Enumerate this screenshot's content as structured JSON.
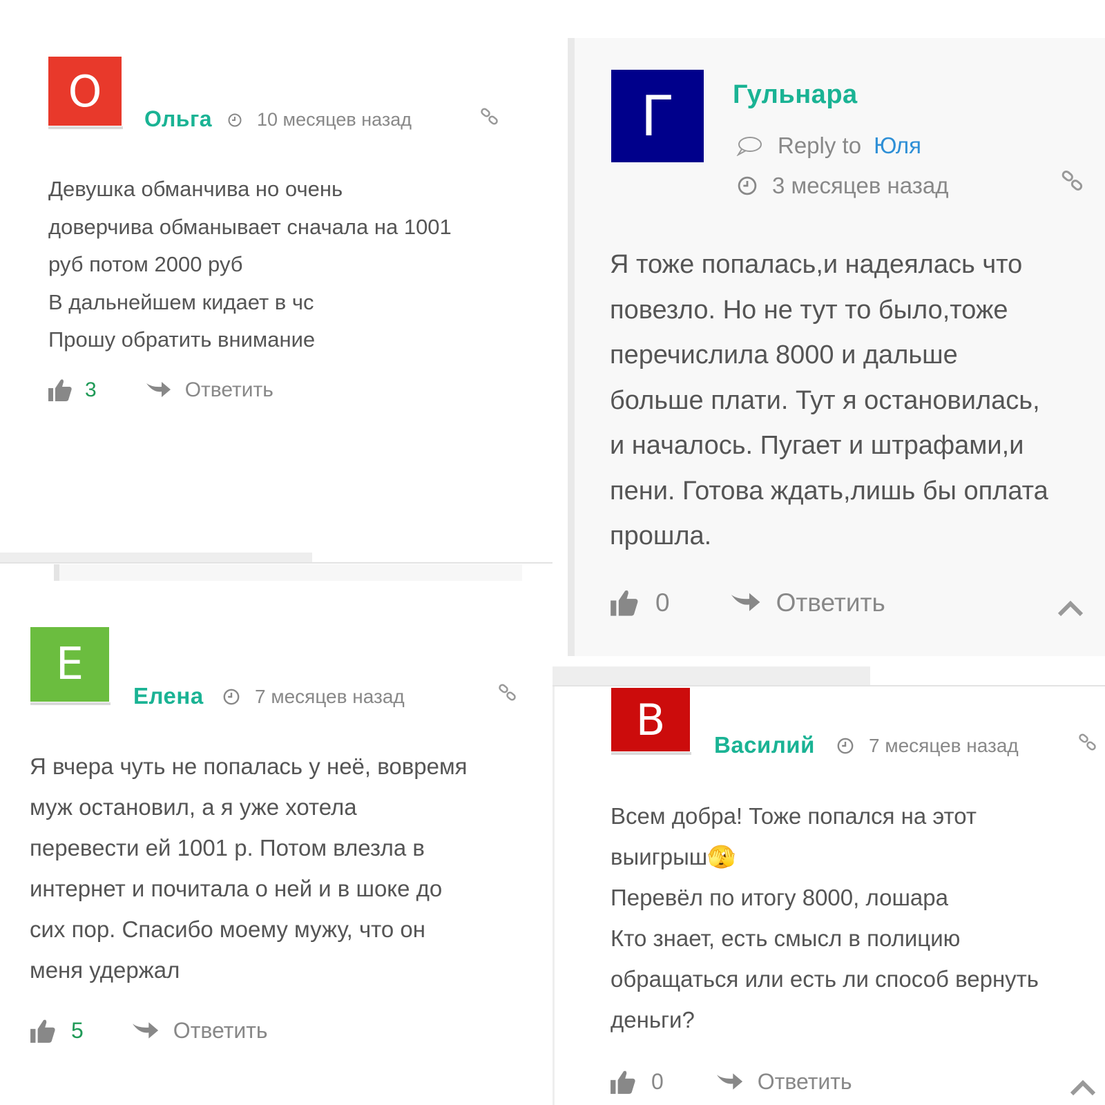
{
  "colors": {
    "accent": "#1ab394",
    "like": "#1f9a57",
    "reply_to_name": "#2e8fd6",
    "meta": "#888888",
    "text": "#555555"
  },
  "comments": [
    {
      "avatar_letter": "О",
      "avatar_color": "#e8392b",
      "author": "Ольга",
      "time": "10 месяцев назад",
      "lines": [
        "Девушка обманчива но очень",
        "доверчива обманывает сначала на 1001",
        "руб потом 2000 руб",
        "В дальнейшем кидает в чс",
        "Прошу обратить внимание"
      ],
      "likes": "3",
      "reply_label": "Ответить"
    },
    {
      "avatar_letter": "Г",
      "avatar_color": "#00008b",
      "author": "Гульнара",
      "reply_to_label": "Reply to",
      "reply_to_name": "Юля",
      "time": "3 месяцев назад",
      "lines": [
        "Я тоже попалась,и надеялась что",
        "повезло. Но не тут то было,тоже",
        "перечислила 8000 и дальше",
        "больше плати. Тут я остановилась,",
        "и началось. Пугает и штрафами,и",
        "пени. Готова ждать,лишь бы оплата",
        "прошла."
      ],
      "likes": "0",
      "reply_label": "Ответить"
    },
    {
      "avatar_letter": "Е",
      "avatar_color": "#6bbd3f",
      "author": "Елена",
      "time": "7 месяцев назад",
      "lines": [
        "Я вчера чуть не попалась у неё, вовремя",
        "муж остановил, а я уже хотела",
        "перевести ей 1001 р. Потом влезла в",
        "интернет и почитала о ней и в шоке до",
        "сих пор. Спасибо моему мужу, что он",
        "меня удержал"
      ],
      "likes": "5",
      "reply_label": "Ответить"
    },
    {
      "avatar_letter": "В",
      "avatar_color": "#cc0c0c",
      "author": "Василий",
      "time": "7 месяцев назад",
      "lines": [
        "Всем добра! Тоже попался на этот",
        "выигрыш🫣",
        "Перевёл по итогу 8000, лошара",
        "Кто знает, есть смысл в полицию",
        "обращаться или есть ли способ вернуть",
        "деньги?"
      ],
      "likes": "0",
      "reply_label": "Ответить"
    }
  ]
}
